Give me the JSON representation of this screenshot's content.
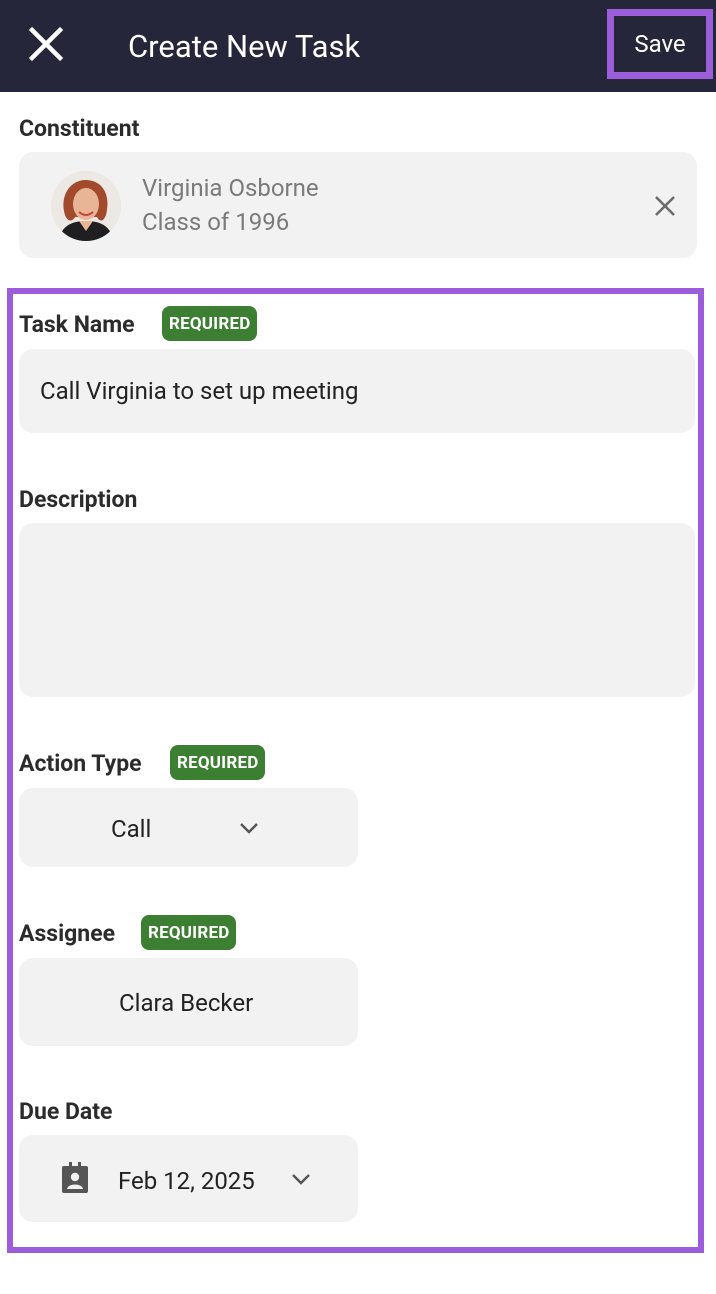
{
  "appbar": {
    "title": "Create New Task",
    "save_label": "Save"
  },
  "constituent": {
    "label": "Constituent",
    "name": "Virginia Osborne",
    "class_text": "Class of 1996"
  },
  "task_name": {
    "label": "Task Name",
    "badge": "REQUIRED",
    "value": "Call Virginia to set up meeting"
  },
  "description": {
    "label": "Description",
    "value": ""
  },
  "action_type": {
    "label": "Action Type",
    "badge": "REQUIRED",
    "value": "Call"
  },
  "assignee": {
    "label": "Assignee",
    "badge": "REQUIRED",
    "value": "Clara Becker"
  },
  "due_date": {
    "label": "Due Date",
    "value": "Feb 12, 2025"
  },
  "colors": {
    "appbar": "#252639",
    "highlight": "#9c5ddb",
    "badge": "#3d7f32",
    "field_bg": "#f2f2f2"
  },
  "icons": [
    "close-icon",
    "clear-icon",
    "chevron-down-icon",
    "calendar-icon"
  ]
}
